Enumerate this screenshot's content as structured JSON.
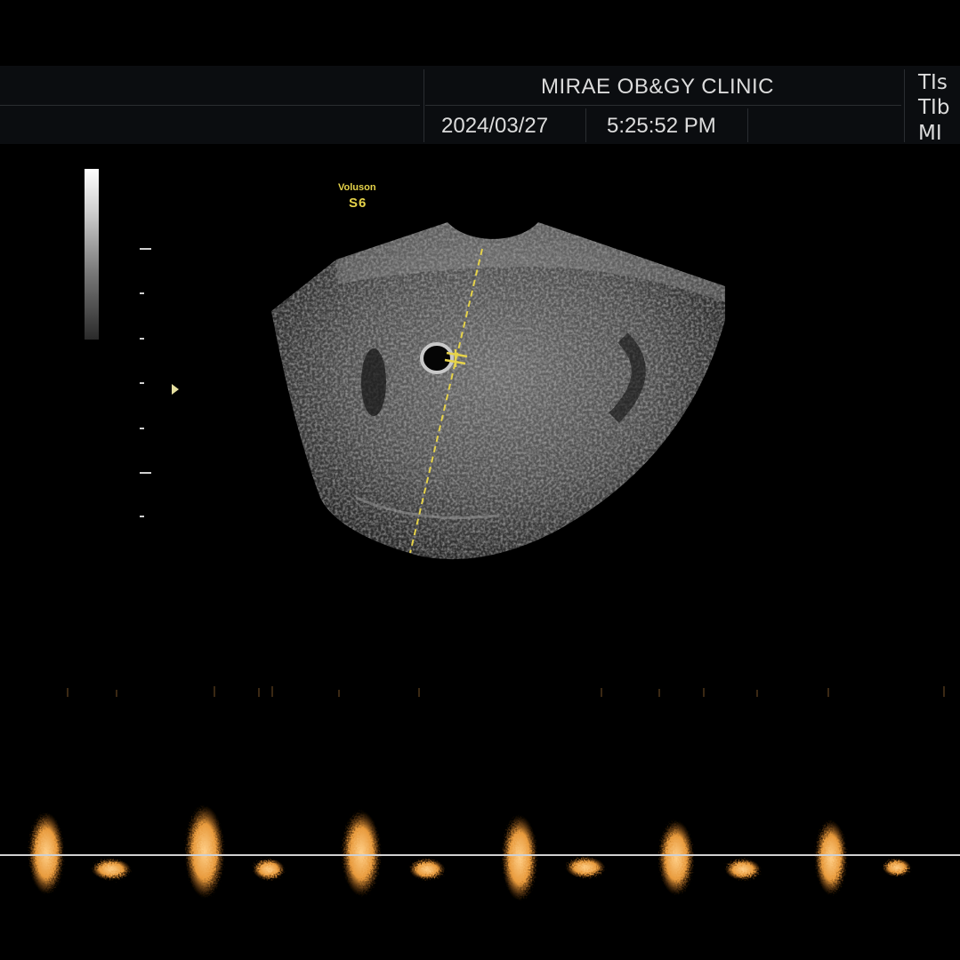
{
  "header": {
    "clinic": "MIRAE OB&GY CLINIC",
    "date": "2024/03/27",
    "time": "5:25:52 PM",
    "indices": [
      "TIs",
      "TIb",
      "MI"
    ]
  },
  "probe": {
    "brand": "Voluson",
    "model": "S6"
  },
  "colors": {
    "annotation": "#e6d34a",
    "doppler": "#f0a040",
    "baseline": "#d0d0d0"
  },
  "icons": {
    "focus_marker": "triangle-right",
    "measurement_caliper": "plus-caliper"
  }
}
